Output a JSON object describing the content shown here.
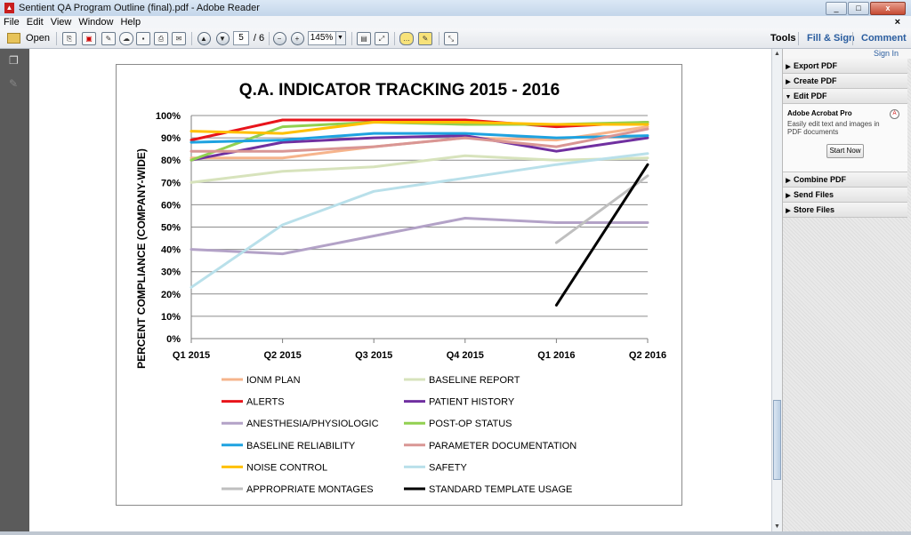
{
  "window": {
    "title": "Sentient QA Program Outline (final).pdf - Adobe Reader",
    "controls": [
      "_",
      "□",
      "x"
    ]
  },
  "menu": {
    "items": [
      "File",
      "Edit",
      "View",
      "Window",
      "Help"
    ],
    "close": "×"
  },
  "toolbar": {
    "open_label": "Open",
    "page_current": "5",
    "page_total": "/ 6",
    "zoom": "145%",
    "tools": "Tools",
    "fill_sign": "Fill & Sign",
    "comment": "Comment"
  },
  "right_panel": {
    "sign_in": "Sign In",
    "sections": [
      "Export PDF",
      "Create PDF",
      "Edit PDF",
      "Combine PDF",
      "Send Files",
      "Store Files"
    ],
    "edit_heading": "Adobe Acrobat Pro",
    "edit_desc": "Easily edit text and images in PDF documents",
    "start_now": "Start Now"
  },
  "chart_data": {
    "type": "line",
    "title": "Q.A. INDICATOR TRACKING 2015 - 2016",
    "xlabel": "",
    "ylabel": "PERCENT COMPLIANCE (COMPANY-WIDE)",
    "categories": [
      "Q1 2015",
      "Q2 2015",
      "Q3 2015",
      "Q4 2015",
      "Q1 2016",
      "Q2 2016"
    ],
    "ylim": [
      0,
      100
    ],
    "yticks": [
      "0%",
      "10%",
      "20%",
      "30%",
      "40%",
      "50%",
      "60%",
      "70%",
      "80%",
      "90%",
      "100%"
    ],
    "grid": true,
    "legend_position": "bottom",
    "series": [
      {
        "name": "IONM PLAN",
        "color": "#f6b48c",
        "values": [
          81,
          81,
          86,
          90,
          89,
          95
        ]
      },
      {
        "name": "BASELINE REPORT",
        "color": "#d7e3bc",
        "values": [
          70,
          75,
          77,
          82,
          80,
          81
        ]
      },
      {
        "name": "ALERTS",
        "color": "#e8141b",
        "values": [
          89,
          98,
          98,
          98,
          95,
          97
        ]
      },
      {
        "name": "PATIENT HISTORY",
        "color": "#7030a0",
        "values": [
          80,
          88,
          90,
          91,
          84,
          90
        ]
      },
      {
        "name": "ANESTHESIA/PHYSIOLOGIC",
        "color": "#b3a2c7",
        "values": [
          40,
          38,
          46,
          54,
          52,
          52
        ]
      },
      {
        "name": "POST-OP STATUS",
        "color": "#92d050",
        "values": [
          80,
          95,
          97,
          96,
          96,
          97
        ]
      },
      {
        "name": "BASELINE RELIABILITY",
        "color": "#1ea2e0",
        "values": [
          88,
          89,
          92,
          92,
          90,
          91
        ]
      },
      {
        "name": "PARAMETER DOCUMENTATION",
        "color": "#d99694",
        "values": [
          84,
          84,
          86,
          90,
          86,
          94
        ]
      },
      {
        "name": "NOISE CONTROL",
        "color": "#ffc000",
        "values": [
          93,
          92,
          97,
          97,
          96,
          96
        ]
      },
      {
        "name": "SAFETY",
        "color": "#b9e0ea",
        "values": [
          23,
          51,
          66,
          72,
          78,
          83
        ]
      },
      {
        "name": "APPROPRIATE MONTAGES",
        "color": "#bfbfbf",
        "values": [
          null,
          null,
          null,
          null,
          43,
          73
        ]
      },
      {
        "name": "STANDARD TEMPLATE USAGE",
        "color": "#000000",
        "values": [
          null,
          null,
          null,
          null,
          15,
          78
        ]
      }
    ]
  }
}
